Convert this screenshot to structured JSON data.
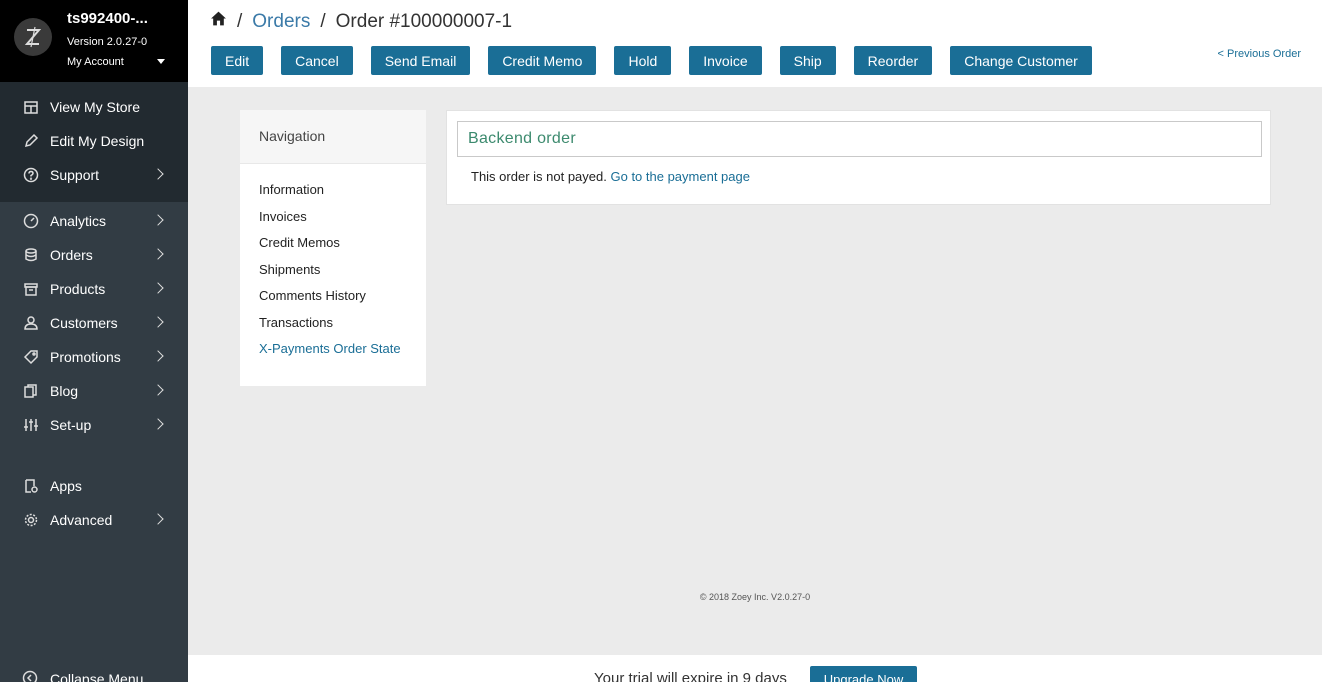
{
  "account": {
    "store_name": "ts992400-...",
    "version": "Version 2.0.27-0",
    "my_account": "My Account"
  },
  "sidebar": {
    "top_items": [
      {
        "label": "View My Store",
        "icon": "store-icon"
      },
      {
        "label": "Edit My Design",
        "icon": "pencil-icon"
      },
      {
        "label": "Support",
        "icon": "help-icon"
      }
    ],
    "main_items": [
      {
        "label": "Analytics",
        "icon": "gauge-icon"
      },
      {
        "label": "Orders",
        "icon": "database-icon"
      },
      {
        "label": "Products",
        "icon": "box-icon"
      },
      {
        "label": "Customers",
        "icon": "user-icon"
      },
      {
        "label": "Promotions",
        "icon": "tag-icon"
      },
      {
        "label": "Blog",
        "icon": "copy-icon"
      },
      {
        "label": "Set-up",
        "icon": "sliders-icon"
      }
    ],
    "extra_items": [
      {
        "label": "Apps",
        "icon": "apps-icon"
      },
      {
        "label": "Advanced",
        "icon": "gear-icon"
      }
    ],
    "collapse_label": "Collapse Menu"
  },
  "breadcrumb": {
    "section": "Orders",
    "current": "Order #100000007-1"
  },
  "actions": [
    "Edit",
    "Cancel",
    "Send Email",
    "Credit Memo",
    "Hold",
    "Invoice",
    "Ship",
    "Reorder",
    "Change Customer"
  ],
  "previous_order": "< Previous Order",
  "navigation": {
    "title": "Navigation",
    "items": [
      "Information",
      "Invoices",
      "Credit Memos",
      "Shipments",
      "Comments History",
      "Transactions",
      "X-Payments Order State"
    ]
  },
  "order": {
    "backend_label": "Backend order",
    "not_payed_text": "This order is not payed.",
    "payment_link": "Go to the payment page"
  },
  "footer": {
    "copyright": "© 2018 Zoey Inc. V2.0.27-0"
  },
  "trial": {
    "text": "Your trial will expire in 9 days",
    "upgrade_label": "Upgrade Now"
  },
  "colors": {
    "accent": "#1a6e96",
    "sidebar": "#323c44",
    "backend_text": "#3c8a6e"
  }
}
